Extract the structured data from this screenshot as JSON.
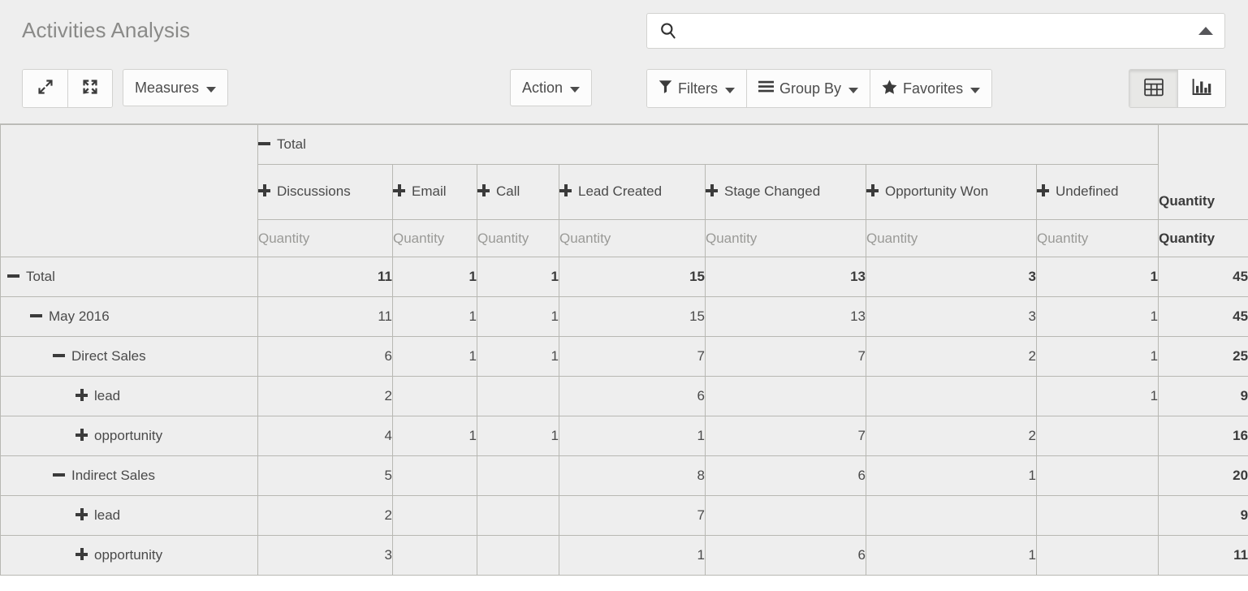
{
  "header": {
    "title": "Activities Analysis",
    "expand_icon": "expand-diagonal-icon",
    "fullscreen_icon": "expand-all-arrows-icon",
    "measures_label": "Measures",
    "action_label": "Action",
    "filters_label": "Filters",
    "group_by_label": "Group By",
    "favorites_label": "Favorites",
    "search": {
      "value": "",
      "placeholder": ""
    },
    "view_switcher": {
      "pivot_label": "Pivot view",
      "graph_label": "Graph view",
      "active": "pivot"
    }
  },
  "colors": {
    "panel_bg": "#eeeeee",
    "cell_bg": "#eeeeee",
    "border": "#b8b8b3",
    "title_text": "#8a8a88",
    "body_text": "#4a4a4a",
    "muted_text": "#9a9a97"
  },
  "chart_data": {
    "type": "table",
    "title": "Activities Analysis",
    "measure": "Quantity",
    "col_group_root": "Total",
    "categories": [
      "Discussions",
      "Email",
      "Call",
      "Lead Created",
      "Stage Changed",
      "Opportunity Won",
      "Undefined"
    ],
    "grand_total_label": "Quantity",
    "rows": [
      {
        "label": "Total",
        "level": 0,
        "state": "minus",
        "bold": true,
        "values": [
          11,
          1,
          1,
          15,
          13,
          3,
          1
        ],
        "total": 45
      },
      {
        "label": "May 2016",
        "level": 1,
        "state": "minus",
        "bold": false,
        "values": [
          11,
          1,
          1,
          15,
          13,
          3,
          1
        ],
        "total": 45
      },
      {
        "label": "Direct Sales",
        "level": 2,
        "state": "minus",
        "bold": false,
        "values": [
          6,
          1,
          1,
          7,
          7,
          2,
          1
        ],
        "total": 25
      },
      {
        "label": "lead",
        "level": 3,
        "state": "plus",
        "bold": false,
        "values": [
          2,
          "",
          "",
          6,
          "",
          "",
          1
        ],
        "total": 9
      },
      {
        "label": "opportunity",
        "level": 3,
        "state": "plus",
        "bold": false,
        "values": [
          4,
          1,
          1,
          1,
          7,
          2,
          ""
        ],
        "total": 16
      },
      {
        "label": "Indirect Sales",
        "level": 2,
        "state": "minus",
        "bold": false,
        "values": [
          5,
          "",
          "",
          8,
          6,
          1,
          ""
        ],
        "total": 20
      },
      {
        "label": "lead",
        "level": 3,
        "state": "plus",
        "bold": false,
        "values": [
          2,
          "",
          "",
          7,
          "",
          "",
          ""
        ],
        "total": 9
      },
      {
        "label": "opportunity",
        "level": 3,
        "state": "plus",
        "bold": false,
        "values": [
          3,
          "",
          "",
          1,
          6,
          1,
          ""
        ],
        "total": 11
      }
    ]
  }
}
